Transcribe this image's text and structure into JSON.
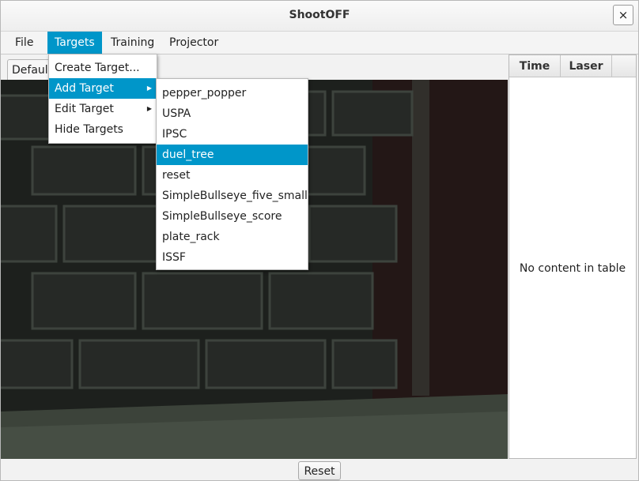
{
  "window": {
    "title": "ShootOFF",
    "close_icon": "×"
  },
  "menubar": {
    "file": "File",
    "targets": "Targets",
    "training": "Training",
    "projector": "Projector"
  },
  "targets_menu": {
    "items": [
      {
        "label": "Create Target..."
      },
      {
        "label": "Add Target",
        "arrow": "▶"
      },
      {
        "label": "Edit Target",
        "arrow": "▶"
      },
      {
        "label": "Hide Targets"
      }
    ]
  },
  "add_target_menu": {
    "items": [
      "pepper_popper",
      "USPA",
      "IPSC",
      "duel_tree",
      "reset",
      "SimpleBullseye_five_small",
      "SimpleBullseye_score",
      "plate_rack",
      "ISSF"
    ],
    "highlighted": "duel_tree"
  },
  "camera_tab": {
    "label": "Default"
  },
  "shot_table": {
    "columns": [
      "Time",
      "Laser"
    ],
    "empty_text": "No content in table"
  },
  "reset_button": "Reset"
}
